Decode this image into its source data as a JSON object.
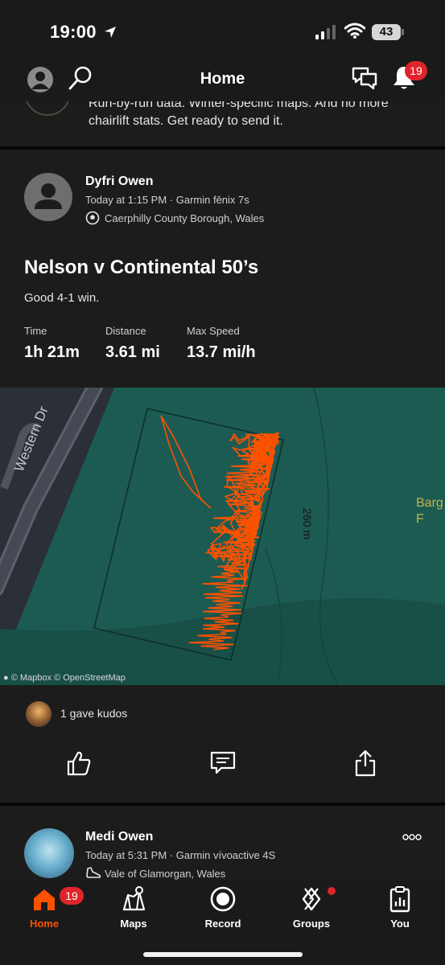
{
  "status_bar": {
    "time": "19:00",
    "battery": "43"
  },
  "header": {
    "title": "Home",
    "notification_count": "19"
  },
  "promo": {
    "text": "Run-by-run data. Winter-specific maps. And no more chairlift stats. Get ready to send it."
  },
  "activity": {
    "athlete": "Dyfri Owen",
    "meta": "Today at 1:15 PM · Garmin fēnix 7s",
    "location": "Caerphilly County Borough, Wales",
    "title": "Nelson v Continental 50’s",
    "description": "Good 4-1 win.",
    "stats": [
      {
        "label": "Time",
        "value": "1h 21m"
      },
      {
        "label": "Distance",
        "value": "3.61 mi"
      },
      {
        "label": "Max Speed",
        "value": "13.7 mi/h"
      }
    ],
    "map": {
      "road_label": "Western Dr",
      "distance_label": "260 m",
      "edge_label": "Barg\nF",
      "attribution": "© Mapbox © OpenStreetMap",
      "route_color": "#fc5200"
    },
    "kudos_text": "1 gave kudos"
  },
  "activity2": {
    "athlete": "Medi Owen",
    "meta": "Today at 5:31 PM · Garmin vívoactive 4S",
    "location": "Vale of Glamorgan, Wales"
  },
  "tabs": [
    {
      "label": "Home",
      "icon": "home-icon",
      "badge": "19"
    },
    {
      "label": "Maps",
      "icon": "map-icon"
    },
    {
      "label": "Record",
      "icon": "record-icon"
    },
    {
      "label": "Groups",
      "icon": "groups-icon"
    },
    {
      "label": "You",
      "icon": "stats-icon"
    }
  ],
  "colors": {
    "accent": "#fc5200",
    "badge": "#e0242b",
    "map_green": "#1c5b52"
  }
}
